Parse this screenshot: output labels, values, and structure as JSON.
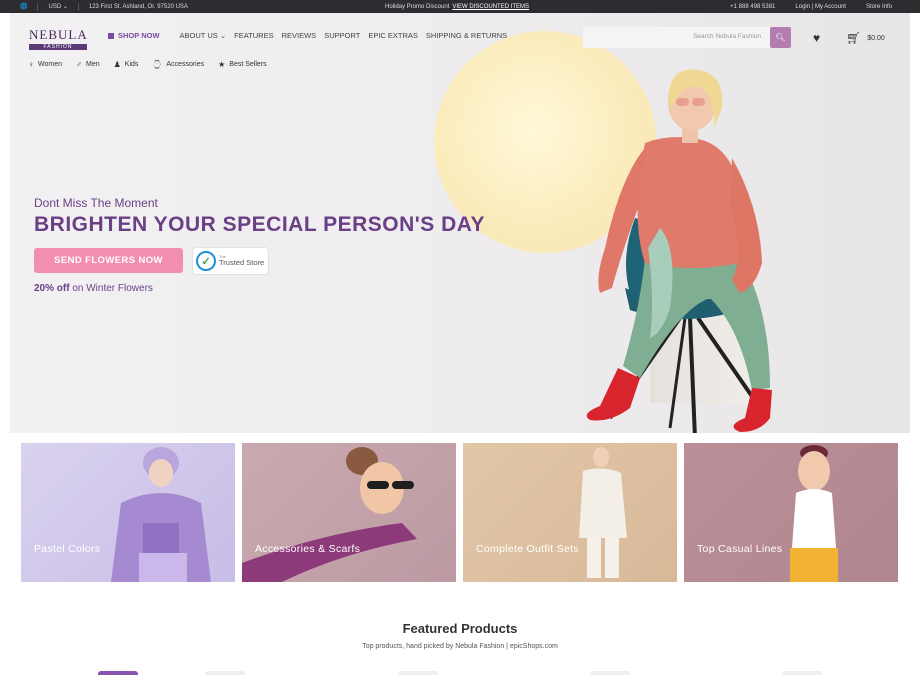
{
  "topbar": {
    "currency": "USD",
    "address": "123 First St. Ashland, Or. 97520 USA",
    "promo": "Holiday Promo Discount",
    "promo_link": "VIEW DISCOUNTED ITEMS",
    "phone": "+1 888 498 5381",
    "account": "Login | My Account",
    "store_info": "Store Info"
  },
  "logo": {
    "name": "NEBULA",
    "tagline": "FASHION"
  },
  "nav": {
    "shop_now": "SHOP NOW",
    "items": [
      "ABOUT US",
      "FEATURES",
      "REVIEWS",
      "SUPPORT",
      "EPIC EXTRAS",
      "SHIPPING & RETURNS"
    ]
  },
  "search": {
    "placeholder": "Search Nebula Fashion"
  },
  "cart": {
    "total": "$0.00"
  },
  "categories": [
    "Women",
    "Men",
    "Kids",
    "Accessories",
    "Best Sellers"
  ],
  "hero": {
    "eyebrow": "Dont Miss The Moment",
    "title": "BRIGHTEN YOUR SPECIAL PERSON'S DAY",
    "button": "SEND FLOWERS NOW",
    "trust_small": "The",
    "trust_label": "Trusted Store",
    "offer_bold": "20% off",
    "offer_rest": " on Winter Flowers"
  },
  "tiles": [
    "Pastel Colors",
    "Accessories & Scarfs",
    "Complete Outfit Sets",
    "Top Casual Lines"
  ],
  "featured": {
    "title": "Featured Products",
    "subtitle": "Top products, hand picked by Nebula Fashion | epicShops.com"
  },
  "colors": {
    "brand_purple": "#6a3f86",
    "cta_pink": "#f38fae",
    "search_button": "#b47db0",
    "topbar": "#2d2d31"
  }
}
